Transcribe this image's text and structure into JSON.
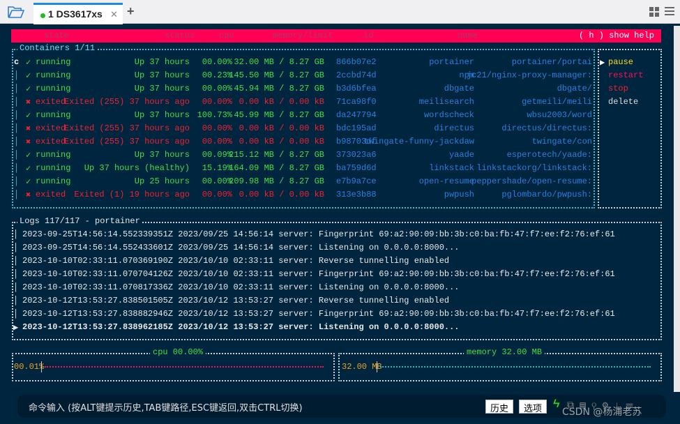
{
  "tabs": [
    {
      "label": "1 DS3617xs",
      "status_color": "#22bb22"
    }
  ],
  "header": {
    "columns": [
      "state",
      "status",
      "cpu",
      "memory/limit",
      "id",
      "name"
    ],
    "help": "( h ) show help",
    "bg": "#ff0055"
  },
  "containers": {
    "title": "Containers 1/11",
    "rows": [
      {
        "state": "running",
        "status": "Up 37 hours",
        "cpu": "00.00%",
        "mem": "32.00 MB / 8.27 GB",
        "id": "866b07e2",
        "name": "portainer",
        "image": "portainer/portai"
      },
      {
        "state": "running",
        "status": "Up 37 hours",
        "cpu": "00.23%",
        "mem": "145.50 MB / 8.27 GB",
        "id": "2ccbd74d",
        "name": "npm",
        "image": "jc21/nginx-proxy-manager:"
      },
      {
        "state": "running",
        "status": "Up 37 hours",
        "cpu": "00.00%",
        "mem": "45.94 MB / 8.27 GB",
        "id": "b3d6bfea",
        "name": "dbgate",
        "image": "dbgate/"
      },
      {
        "state": "exited",
        "status": "Exited (255) 37 hours ago",
        "cpu": "00.00%",
        "mem": "0.00 kB / 0.00 kB",
        "id": "71ca98f0",
        "name": "meilisearch",
        "image": "getmeili/meili"
      },
      {
        "state": "running",
        "status": "Up 37 hours",
        "cpu": "100.73%",
        "mem": "45.99 MB / 8.27 GB",
        "id": "da247794",
        "name": "wordscheck",
        "image": "wbsu2003/word"
      },
      {
        "state": "exited",
        "status": "Exited (255) 37 hours ago",
        "cpu": "00.00%",
        "mem": "0.00 kB / 0.00 kB",
        "id": "bdc195ad",
        "name": "directus",
        "image": "directus/directus:"
      },
      {
        "state": "exited",
        "status": "Exited (255) 37 hours ago",
        "cpu": "00.00%",
        "mem": "0.00 kB / 0.00 kB",
        "id": "b98703df",
        "name": "twingate-funny-jackdaw",
        "image": "twingate/con"
      },
      {
        "state": "running",
        "status": "Up 37 hours",
        "cpu": "00.09%",
        "mem": "215.12 MB / 8.27 GB",
        "id": "373023a6",
        "name": "yaade",
        "image": "esperotech/yaade:"
      },
      {
        "state": "running",
        "status": "Up 37 hours (healthy)",
        "cpu": "15.19%",
        "mem": "164.09 MB / 8.27 GB",
        "id": "ba759d6d",
        "name": "linkstack",
        "image": "linkstackorg/linkstack:"
      },
      {
        "state": "running",
        "status": "Up 25 hours",
        "cpu": "00.00%",
        "mem": "209.98 MB / 8.27 GB",
        "id": "e7b9a7ce",
        "name": "open-resume",
        "image": "peppershade/open-resume:"
      },
      {
        "state": "exited",
        "status": "Exited (1) 19 hours ago",
        "cpu": "00.00%",
        "mem": "0.00 kB / 0.00 kB",
        "id": "313e3b88",
        "name": "pwpush",
        "image": "pglombardo/pwpush:"
      }
    ],
    "cursor": "c"
  },
  "actions": [
    {
      "label": "pause",
      "color": "#ffdd22",
      "selected": true
    },
    {
      "label": "restart",
      "color": "#ff1155"
    },
    {
      "label": "stop",
      "color": "#ee2233"
    },
    {
      "label": "delete",
      "color": "#dddddd"
    }
  ],
  "logs": {
    "title": "Logs 117/117 - portainer",
    "lines": [
      "2023-09-25T14:56:14.552339351Z 2023/09/25 14:56:14 server: Fingerprint 69:a2:90:09:bb:3b:c0:ba:fb:47:f7:ee:f2:76:ef:61",
      "2023-09-25T14:56:14.552433601Z 2023/09/25 14:56:14 server: Listening on 0.0.0.0:8000...",
      "2023-10-10T02:33:11.070369190Z 2023/10/10 02:33:11 server: Reverse tunnelling enabled",
      "2023-10-10T02:33:11.070704126Z 2023/10/10 02:33:11 server: Fingerprint 69:a2:90:09:bb:3b:c0:ba:fb:47:f7:ee:f2:76:ef:61",
      "2023-10-10T02:33:11.070817336Z 2023/10/10 02:33:11 server: Listening on 0.0.0.0:8000...",
      "2023-10-12T13:53:27.838501505Z 2023/10/12 13:53:27 server: Reverse tunnelling enabled",
      "2023-10-12T13:53:27.838882946Z 2023/10/12 13:53:27 server: Fingerprint 69:a2:90:09:bb:3b:c0:ba:fb:47:f7:ee:f2:76:ef:61",
      "2023-10-12T13:53:27.838962185Z 2023/10/12 13:53:27 server: Listening on 0.0.0.0:8000..."
    ],
    "selected_index": 7
  },
  "cpu": {
    "title": "cpu 00.00%",
    "value": "00.01%",
    "color": "#ff1155"
  },
  "memory": {
    "title": "memory 32.00 MB",
    "value": "32.00 MB",
    "color": "#22bbbb"
  },
  "command": {
    "placeholder": "命令输入 (按ALT键提示历史,TAB键路径,ESC键返回,双击CTRL切换)",
    "history": "历史",
    "options": "选项"
  },
  "watermark": "CSDN @杨浦老苏"
}
